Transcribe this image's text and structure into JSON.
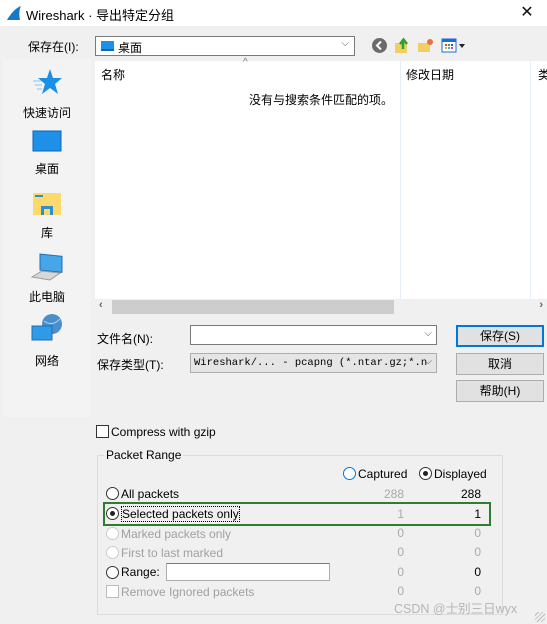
{
  "window": {
    "title": "Wireshark · 导出特定分组",
    "close_glyph": "✕",
    "app_icon": "wireshark-fin-icon"
  },
  "save_in": {
    "label": "保存在(I):",
    "value": "桌面",
    "chevron": "⌵"
  },
  "toolbar": {
    "icons": [
      "back-icon",
      "up-folder-icon",
      "new-folder-icon",
      "view-menu-icon"
    ]
  },
  "places": [
    {
      "label": "快速访问",
      "icon": "quick-access-star-icon"
    },
    {
      "label": "桌面",
      "icon": "desktop-icon"
    },
    {
      "label": "库",
      "icon": "library-icon"
    },
    {
      "label": "此电脑",
      "icon": "this-pc-icon"
    },
    {
      "label": "网络",
      "icon": "network-icon"
    }
  ],
  "file_list": {
    "columns": [
      "名称",
      "修改日期",
      "类"
    ],
    "sort_indicator": "^",
    "empty_message": "没有与搜索条件匹配的项。"
  },
  "scrollbar": {
    "left": "‹",
    "right": "›"
  },
  "filename": {
    "label": "文件名(N):",
    "value": ""
  },
  "filetype": {
    "label": "保存类型(T):",
    "value": "Wireshark/... - pcapng (*.ntar.gz;*.n"
  },
  "buttons": {
    "save": "保存(S)",
    "cancel": "取消",
    "help": "帮助(H)"
  },
  "compress": {
    "label": "Compress with gzip",
    "checked": false
  },
  "packet_range": {
    "title": "Packet Range",
    "columns": {
      "captured": "Captured",
      "displayed": "Displayed",
      "selected": "displayed"
    },
    "rows": [
      {
        "label": "All packets",
        "captured": "288",
        "displayed": "288",
        "enabled": true,
        "selected": false
      },
      {
        "label": "Selected packets only",
        "captured": "1",
        "displayed": "1",
        "enabled": true,
        "selected": true
      },
      {
        "label": "Marked packets only",
        "captured": "0",
        "displayed": "0",
        "enabled": false,
        "selected": false
      },
      {
        "label": "First to last marked",
        "captured": "0",
        "displayed": "0",
        "enabled": false,
        "selected": false
      },
      {
        "label": "Range:",
        "captured": "0",
        "displayed": "0",
        "enabled": true,
        "selected": false,
        "input_value": ""
      },
      {
        "label": "Remove Ignored packets",
        "captured": "0",
        "displayed": "0",
        "enabled": false,
        "selected": false
      }
    ]
  },
  "highlight_color": "#2e7d32",
  "watermark": "CSDN @士别三日wyx"
}
